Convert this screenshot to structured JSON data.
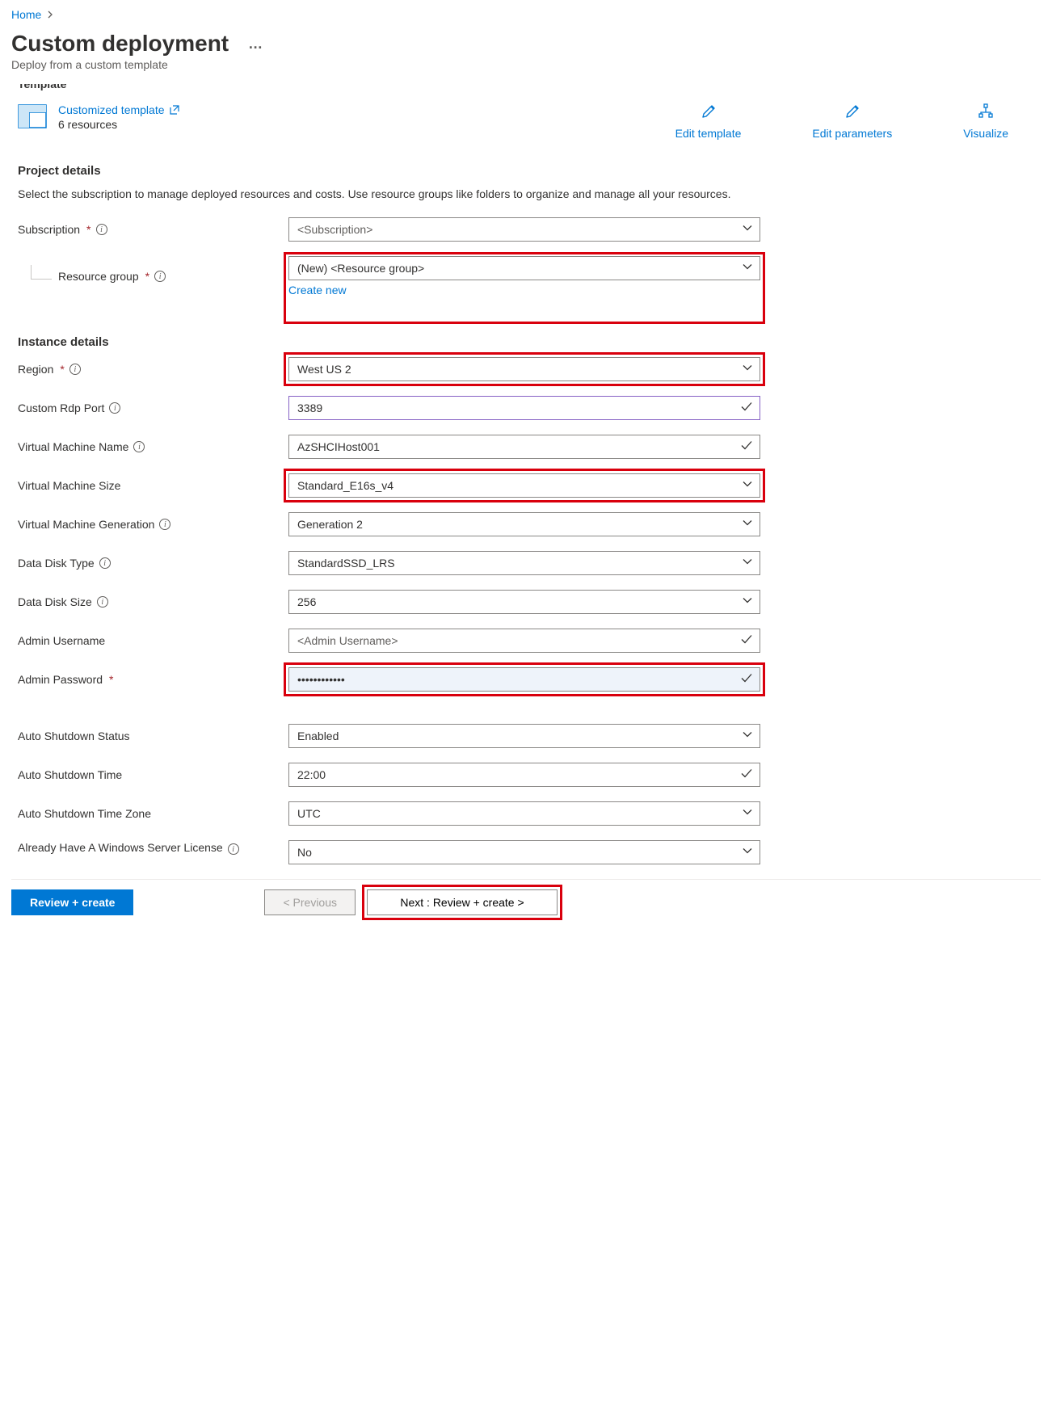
{
  "breadcrumb": {
    "home": "Home"
  },
  "page": {
    "title": "Custom deployment",
    "subtitle": "Deploy from a custom template",
    "more": "…"
  },
  "templateSection": {
    "header_cut": "Template",
    "name": "Customized template",
    "resources": "6 resources",
    "edit_template": "Edit template",
    "edit_parameters": "Edit parameters",
    "visualize": "Visualize"
  },
  "project": {
    "title": "Project details",
    "desc": "Select the subscription to manage deployed resources and costs. Use resource groups like folders to organize and manage all your resources.",
    "subscription_label": "Subscription",
    "subscription_value": "<Subscription>",
    "resource_group_label": "Resource group",
    "resource_group_value": "(New) <Resource group>",
    "create_new": "Create new"
  },
  "instance": {
    "title": "Instance details",
    "region_label": "Region",
    "region_value": "West US 2",
    "rdp_label": "Custom Rdp Port",
    "rdp_value": "3389",
    "vmname_label": "Virtual Machine Name",
    "vmname_value": "AzSHCIHost001",
    "vmsize_label": "Virtual Machine Size",
    "vmsize_value": "Standard_E16s_v4",
    "vmgen_label": "Virtual Machine Generation",
    "vmgen_value": "Generation 2",
    "disktype_label": "Data Disk Type",
    "disktype_value": "StandardSSD_LRS",
    "disksize_label": "Data Disk Size",
    "disksize_value": "256",
    "adminuser_label": "Admin Username",
    "adminuser_value": "<Admin Username>",
    "adminpwd_label": "Admin Password",
    "adminpwd_value": "••••••••••••",
    "autoshut_status_label": "Auto Shutdown Status",
    "autoshut_status_value": "Enabled",
    "autoshut_time_label": "Auto Shutdown Time",
    "autoshut_time_value": "22:00",
    "autoshut_tz_label": "Auto Shutdown Time Zone",
    "autoshut_tz_value": "UTC",
    "license_label": "Already Have A Windows Server License",
    "license_value": "No"
  },
  "footer": {
    "review": "Review + create",
    "previous": "< Previous",
    "next": "Next : Review + create >"
  }
}
